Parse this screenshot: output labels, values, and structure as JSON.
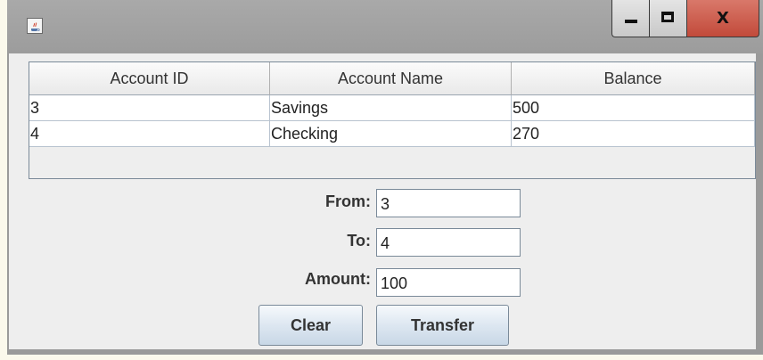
{
  "window": {
    "icon": "java-coffee-cup-icon",
    "minimize_icon": "minimize-icon",
    "maximize_icon": "maximize-icon",
    "close_label": "X"
  },
  "table": {
    "columns": [
      "Account ID",
      "Account Name",
      "Balance"
    ],
    "rows": [
      [
        "3",
        "Savings",
        "500"
      ],
      [
        "4",
        "Checking",
        "270"
      ]
    ]
  },
  "form": {
    "from_label": "From:",
    "from_value": "3",
    "to_label": "To:",
    "to_value": "4",
    "amount_label": "Amount:",
    "amount_value": "100"
  },
  "buttons": {
    "clear_label": "Clear",
    "transfer_label": "Transfer"
  },
  "colors": {
    "close_button": "#c24a3a",
    "button_gradient_bottom": "#c8d7e6",
    "panel_background": "#eeeeee"
  }
}
